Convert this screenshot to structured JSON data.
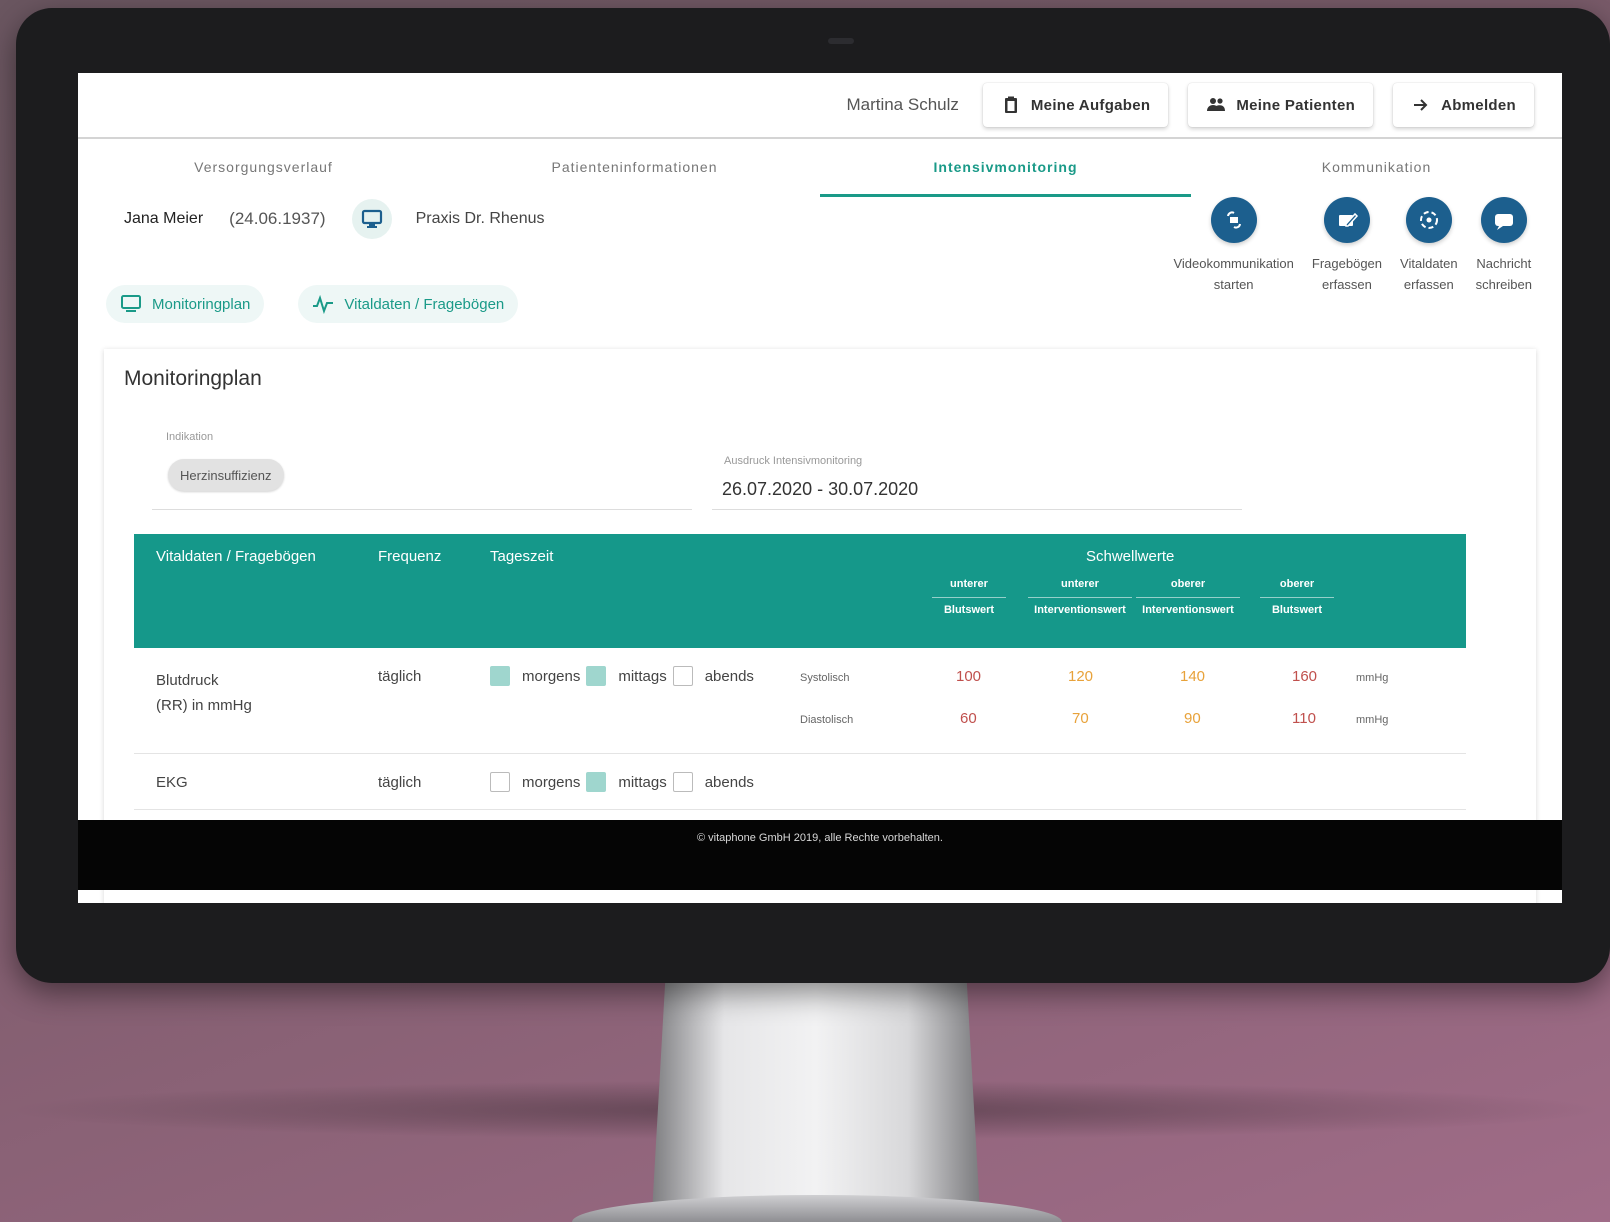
{
  "header": {
    "user_name": "Martina Schulz",
    "buttons": [
      {
        "label": "Meine Aufgaben",
        "icon": "clipboard-icon"
      },
      {
        "label": "Meine Patienten",
        "icon": "people-icon"
      },
      {
        "label": "Abmelden",
        "icon": "arrow-right-icon"
      }
    ]
  },
  "tabs": [
    {
      "label": "Versorgungsverlauf",
      "active": false
    },
    {
      "label": "Patienteninformationen",
      "active": false
    },
    {
      "label": "Intensivmonitoring",
      "active": true
    },
    {
      "label": "Kommunikation",
      "active": false
    }
  ],
  "patient": {
    "name": "Jana Meier",
    "dob": "(24.06.1937)",
    "praxis": "Praxis Dr. Rhenus"
  },
  "actions": [
    {
      "label": [
        "Videokommunikation",
        "starten"
      ],
      "icon": "video-call-icon"
    },
    {
      "label": [
        "Fragebögen",
        "erfassen"
      ],
      "icon": "questionnaire-icon"
    },
    {
      "label": [
        "Vitaldaten",
        "erfassen"
      ],
      "icon": "vitals-icon"
    },
    {
      "label": [
        "Nachricht",
        "schreiben"
      ],
      "icon": "message-icon"
    }
  ],
  "subtabs": [
    {
      "label": "Monitoringplan",
      "icon": "monitor-icon"
    },
    {
      "label": "Vitaldaten / Fragebögen",
      "icon": "pulse-icon"
    }
  ],
  "card": {
    "title": "Monitoringplan",
    "indication_label": "Indikation",
    "indication_value": "Herzinsuffizienz",
    "duration_label": "Ausdruck Intensivmonitoring",
    "duration_value": "26.07.2020 - 30.07.2020"
  },
  "table": {
    "headers": {
      "vital": "Vitaldaten / Fragebögen",
      "frequency": "Frequenz",
      "time": "Tageszeit",
      "thresholds": "Schwellwerte",
      "t1": [
        "unterer",
        "Blutswert"
      ],
      "t2": [
        "unterer",
        "Interventionswert"
      ],
      "t3": [
        "oberer",
        "Interventionswert"
      ],
      "t4": [
        "oberer",
        "Blutswert"
      ]
    },
    "rows": [
      {
        "name": [
          "Blutdruck",
          "(RR) in mmHg"
        ],
        "frequency": "täglich",
        "times": [
          {
            "label": "morgens",
            "checked": true
          },
          {
            "label": "mittags",
            "checked": true
          },
          {
            "label": "abends",
            "checked": false
          }
        ],
        "sub": [
          {
            "label": "Systolisch",
            "values": [
              "100",
              "120",
              "140",
              "160"
            ],
            "unit": "mmHg"
          },
          {
            "label": "Diastolisch",
            "values": [
              "60",
              "70",
              "90",
              "110"
            ],
            "unit": "mmHg"
          }
        ]
      },
      {
        "name": [
          "EKG"
        ],
        "frequency": "täglich",
        "times": [
          {
            "label": "morgens",
            "checked": false
          },
          {
            "label": "mittags",
            "checked": true
          },
          {
            "label": "abends",
            "checked": false
          }
        ]
      }
    ]
  },
  "footer": "© vitaphone GmbH 2019, alle Rechte vorbehalten.",
  "colors": {
    "accent": "#15988a",
    "action_blue": "#1c5f8e",
    "threshold_red": "#c0504d",
    "threshold_orange": "#e8a23a"
  }
}
